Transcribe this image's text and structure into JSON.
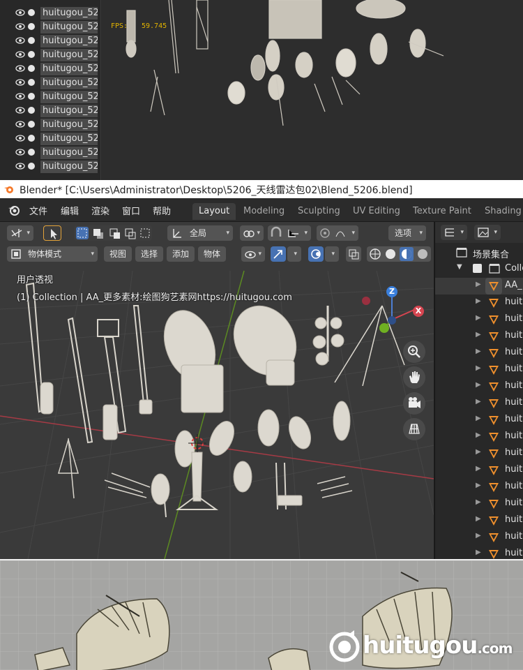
{
  "top_panel": {
    "outliner_rows": [
      "huitugou_52",
      "huitugou_52",
      "huitugou_52",
      "huitugou_52",
      "huitugou_52",
      "huitugou_52",
      "huitugou_52",
      "huitugou_52",
      "huitugou_52",
      "huitugou_52",
      "huitugou_52",
      "huitugou_52"
    ],
    "stats": {
      "fps_label": "FPS:",
      "fps_value": "59.745"
    }
  },
  "window": {
    "title": "Blender* [C:\\Users\\Administrator\\Desktop\\5206_天线雷达包02\\Blend_5206.blend]"
  },
  "menu": {
    "items": [
      "文件",
      "编辑",
      "渲染",
      "窗口",
      "帮助"
    ],
    "workspaces": [
      "Layout",
      "Modeling",
      "Sculpting",
      "UV Editing",
      "Texture Paint",
      "Shading"
    ],
    "active_workspace": "Layout"
  },
  "viewport": {
    "transform_orientation": "全局",
    "options_label": "选项",
    "mode": "物体模式",
    "header_menus": [
      "视图",
      "选择",
      "添加",
      "物体"
    ],
    "view_name": "用户透视",
    "collection_info": "(1) Collection | AA_更多素材:绘图狗艺素网https://huitugou.com",
    "gizmo": {
      "z": "Z",
      "x": "X"
    },
    "colors": {
      "axis_x": "#c0404a",
      "axis_y": "#6fa322",
      "accent": "#4772b3"
    }
  },
  "outliner": {
    "scene_collection": "场景集合",
    "collection": "Collection",
    "first_object": "AA_",
    "objects": [
      "huitu",
      "huitu",
      "huitu",
      "huitu",
      "huitu",
      "huitu",
      "huitu",
      "huitu",
      "huitu",
      "huitu",
      "huitu",
      "huitu",
      "huitu",
      "huitu",
      "huitu",
      "huitu"
    ]
  },
  "watermark": {
    "brand": "huitugou",
    "tld": ".com"
  }
}
